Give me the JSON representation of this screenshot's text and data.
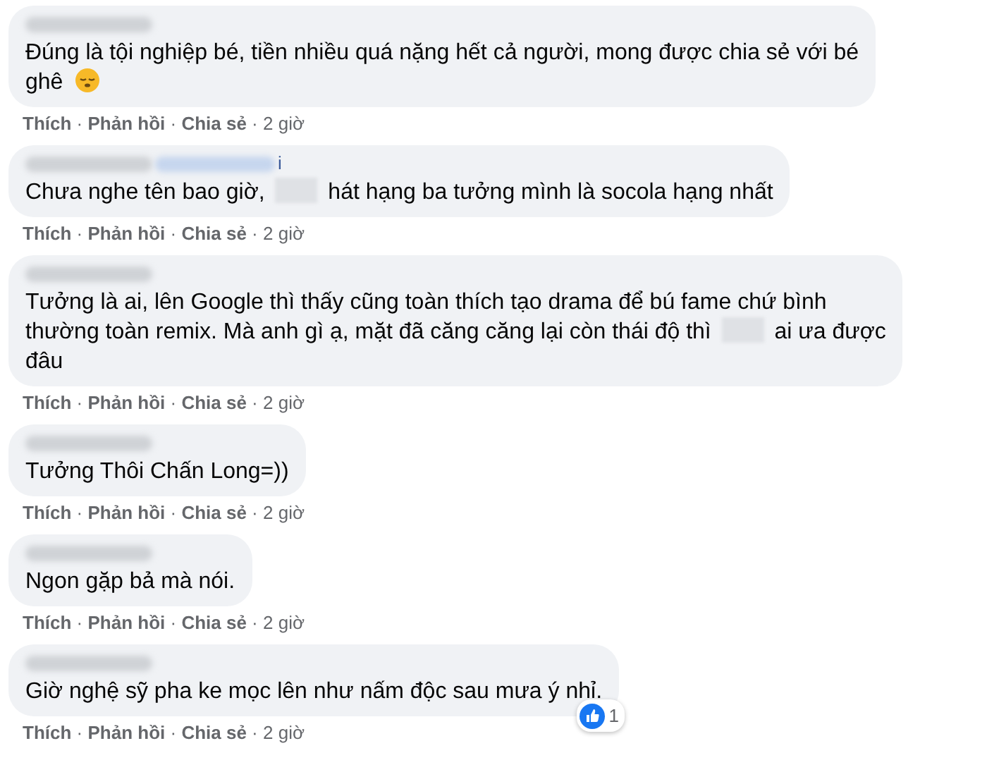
{
  "comments": [
    {
      "lines": [
        [
          {
            "kind": "text",
            "text": "Đúng là tội nghiệp bé, tiền nhiều quá nặng hết cả người, mong được chia sẻ với bé"
          }
        ],
        [
          {
            "kind": "text",
            "text": "ghê"
          },
          {
            "kind": "emoji"
          }
        ]
      ],
      "actions": [
        "Thích",
        "Phản hồi",
        "Chia sẻ"
      ],
      "separator": "·",
      "time": "2 giờ"
    },
    {
      "mention_tail": "i",
      "lines": [
        [
          {
            "kind": "text",
            "text": "Chưa nghe tên bao giờ,"
          },
          {
            "kind": "redacted"
          },
          {
            "kind": "text",
            "text": "hát hạng ba tưởng mình là socola hạng nhất"
          }
        ]
      ],
      "actions": [
        "Thích",
        "Phản hồi",
        "Chia sẻ"
      ],
      "separator": "·",
      "time": "2 giờ"
    },
    {
      "lines": [
        [
          {
            "kind": "text",
            "text": "Tưởng là ai, lên Google thì thấy cũng toàn thích tạo drama để bú fame chứ bình"
          }
        ],
        [
          {
            "kind": "text",
            "text": "thường toàn remix. Mà anh gì ạ, mặt đã căng căng lại còn thái độ thì"
          },
          {
            "kind": "redacted"
          },
          {
            "kind": "text",
            "text": "ai ưa được"
          }
        ],
        [
          {
            "kind": "text",
            "text": "đâu"
          }
        ]
      ],
      "actions": [
        "Thích",
        "Phản hồi",
        "Chia sẻ"
      ],
      "separator": "·",
      "time": "2 giờ"
    },
    {
      "lines": [
        [
          {
            "kind": "text",
            "text": "Tưởng Thôi Chấn Long=))"
          }
        ]
      ],
      "actions": [
        "Thích",
        "Phản hồi",
        "Chia sẻ"
      ],
      "separator": "·",
      "time": "2 giờ"
    },
    {
      "lines": [
        [
          {
            "kind": "text",
            "text": "Ngon gặp bả mà nói."
          }
        ]
      ],
      "actions": [
        "Thích",
        "Phản hồi",
        "Chia sẻ"
      ],
      "separator": "·",
      "time": "2 giờ"
    },
    {
      "lines": [
        [
          {
            "kind": "text",
            "text": "Giờ nghệ sỹ pha ke mọc lên như nấm độc sau mưa ý nhỉ."
          }
        ]
      ],
      "actions": [
        "Thích",
        "Phản hồi",
        "Chia sẻ"
      ],
      "separator": "·",
      "time": "2 giờ",
      "reactions": {
        "count": "1"
      }
    }
  ]
}
